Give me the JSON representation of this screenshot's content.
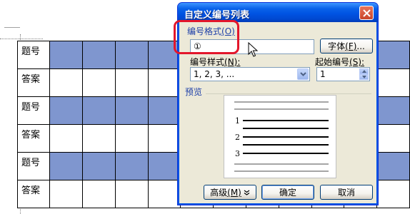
{
  "document": {
    "row_labels": [
      "题号",
      "答案",
      "题号",
      "答案",
      "题号",
      "答案"
    ],
    "row_shading": [
      "shaded",
      "plain",
      "shaded",
      "plain",
      "shaded",
      "plain"
    ],
    "shade_color": "#7f96cf"
  },
  "dialog": {
    "title": "自定义编号列表",
    "format_label": "编号格式",
    "format_hotkey": "(O)",
    "format_value": "①",
    "font_button": "字体",
    "font_hotkey": "(F)",
    "font_suffix": "...",
    "style_label": "编号样式",
    "style_hotkey": "(N):",
    "style_value": "1, 2, 3, ...",
    "start_label": "起始编号",
    "start_hotkey": "(S):",
    "start_value": "1",
    "preview_label": "预览",
    "preview_numbers": [
      "1",
      "2",
      "3"
    ],
    "advanced_button": "高级",
    "advanced_hotkey": "(M)",
    "ok_button": "确定",
    "cancel_button": "取消",
    "title_color": "#0054e3",
    "highlight_color": "#e3162b"
  },
  "icons": {
    "close": "close-icon",
    "dropdown": "chevron-down-icon",
    "spinner": "spinner-arrows-icon",
    "cursor": "mouse-pointer-icon",
    "advanced_arrow": "double-chevron-down-icon"
  }
}
